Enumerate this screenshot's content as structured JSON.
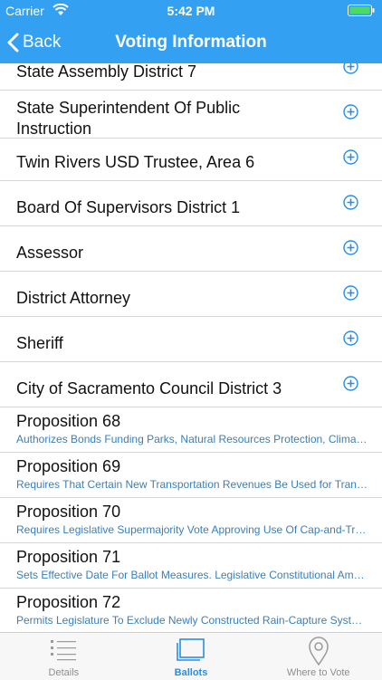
{
  "status_bar": {
    "carrier": "Carrier",
    "time": "5:42 PM"
  },
  "nav": {
    "back_label": "Back",
    "title": "Voting Information"
  },
  "contests": [
    {
      "name": "State Assembly District 7"
    },
    {
      "name": "State Superintendent Of Public Instruction"
    },
    {
      "name": "Twin Rivers USD Trustee, Area 6"
    },
    {
      "name": "Board Of Supervisors District 1"
    },
    {
      "name": "Assessor"
    },
    {
      "name": "District Attorney"
    },
    {
      "name": "Sheriff"
    },
    {
      "name": "City of Sacramento Council District 3"
    }
  ],
  "propositions": [
    {
      "title": "Proposition 68",
      "desc": "Authorizes Bonds Funding Parks, Natural Resources Protection, Climate Adaptation"
    },
    {
      "title": "Proposition 69",
      "desc": "Requires That Certain New Transportation Revenues Be Used for Transportation Purposes"
    },
    {
      "title": "Proposition 70",
      "desc": "Requires Legislative Supermajority Vote Approving Use Of Cap-and-Trade Reserve Fund"
    },
    {
      "title": "Proposition 71",
      "desc": "Sets Effective Date For Ballot Measures. Legislative Constitutional Amendment"
    },
    {
      "title": "Proposition 72",
      "desc": "Permits Legislature To Exclude Newly Constructed Rain-Capture Systems From Property Tax"
    }
  ],
  "tabs": [
    {
      "label": "Details",
      "icon": "list-icon"
    },
    {
      "label": "Ballots",
      "icon": "ballots-icon"
    },
    {
      "label": "Where to Vote",
      "icon": "location-pin-icon"
    }
  ],
  "colors": {
    "accent": "#33a0f2",
    "tab_active": "#2b8ee0",
    "description": "#3a7fb8"
  }
}
